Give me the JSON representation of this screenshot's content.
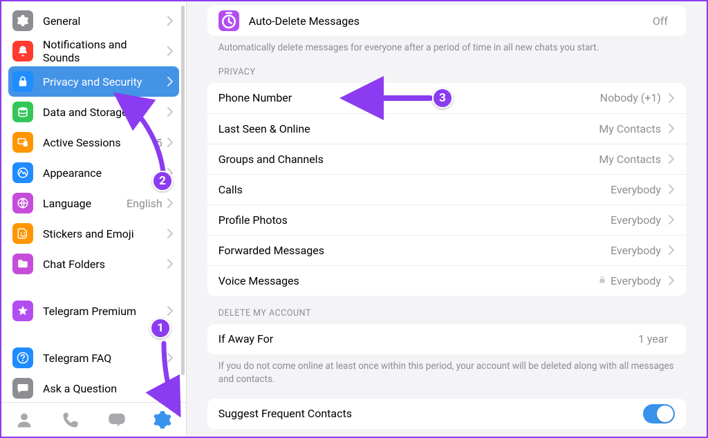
{
  "sidebar": {
    "items": [
      {
        "key": "general",
        "label": "General",
        "value": "",
        "selected": false,
        "icon": "gear",
        "icon_bg": "#8d8d92",
        "icon_fg": "#ffffff"
      },
      {
        "key": "notifications",
        "label": "Notifications and Sounds",
        "value": "",
        "selected": false,
        "icon": "bell",
        "icon_bg": "#ff3b30",
        "icon_fg": "#ffffff"
      },
      {
        "key": "privacy",
        "label": "Privacy and Security",
        "value": "",
        "selected": true,
        "icon": "lock",
        "icon_bg": "#1f8cff",
        "icon_fg": "#ffffff"
      },
      {
        "key": "data",
        "label": "Data and Storage",
        "value": "",
        "selected": false,
        "icon": "storage",
        "icon_bg": "#33c759",
        "icon_fg": "#ffffff"
      },
      {
        "key": "sessions",
        "label": "Active Sessions",
        "value": "5",
        "selected": false,
        "icon": "sessions",
        "icon_bg": "#ff9501",
        "icon_fg": "#ffffff"
      },
      {
        "key": "appearance",
        "label": "Appearance",
        "value": "",
        "selected": false,
        "icon": "appearance",
        "icon_bg": "#1f8cff",
        "icon_fg": "#ffffff"
      },
      {
        "key": "language",
        "label": "Language",
        "value": "English",
        "selected": false,
        "icon": "globe",
        "icon_bg": "#c64dd9",
        "icon_fg": "#ffffff"
      },
      {
        "key": "stickers",
        "label": "Stickers and Emoji",
        "value": "",
        "selected": false,
        "icon": "sticker",
        "icon_bg": "#ff9501",
        "icon_fg": "#ffffff"
      },
      {
        "key": "folders",
        "label": "Chat Folders",
        "value": "",
        "selected": false,
        "icon": "folder",
        "icon_bg": "#c64dd9",
        "icon_fg": "#ffffff"
      },
      {
        "key": "gap1",
        "gap": true
      },
      {
        "key": "premium",
        "label": "Telegram Premium",
        "value": "",
        "selected": false,
        "icon": "star",
        "icon_bg": "#b34df0",
        "icon_fg": "#ffffff"
      },
      {
        "key": "gap2",
        "gap": true
      },
      {
        "key": "faq",
        "label": "Telegram FAQ",
        "value": "",
        "selected": false,
        "icon": "question",
        "icon_bg": "#1f8cff",
        "icon_fg": "#ffffff"
      },
      {
        "key": "ask",
        "label": "Ask a Question",
        "value": "",
        "selected": false,
        "icon": "chat",
        "icon_bg": "#8d8d92",
        "icon_fg": "#ffffff"
      }
    ],
    "tabs": {
      "contacts": "contacts",
      "calls": "calls",
      "chats": "chats",
      "settings": "settings",
      "active": "settings"
    }
  },
  "main": {
    "auto_delete": {
      "label": "Auto-Delete Messages",
      "value": "Off",
      "footer": "Automatically delete messages for everyone after a period of time in all new chats you start."
    },
    "privacy_header": "PRIVACY",
    "privacy_rows": [
      {
        "key": "phone",
        "label": "Phone Number",
        "value": "Nobody (+1)"
      },
      {
        "key": "lastseen",
        "label": "Last Seen & Online",
        "value": "My Contacts"
      },
      {
        "key": "groups",
        "label": "Groups and Channels",
        "value": "My Contacts"
      },
      {
        "key": "calls",
        "label": "Calls",
        "value": "Everybody"
      },
      {
        "key": "photos",
        "label": "Profile Photos",
        "value": "Everybody"
      },
      {
        "key": "forwarded",
        "label": "Forwarded Messages",
        "value": "Everybody"
      },
      {
        "key": "voice",
        "label": "Voice Messages",
        "value": "Everybody",
        "locked": true
      }
    ],
    "delete_header": "DELETE MY ACCOUNT",
    "delete_row": {
      "label": "If Away For",
      "value": "1 year"
    },
    "delete_footer": "If you do not come online at least once within this period, your account will be deleted along with all messages and contacts.",
    "suggest_row": {
      "label": "Suggest Frequent Contacts",
      "on": true
    }
  },
  "annotations": {
    "step1": "1",
    "step2": "2",
    "step3": "3"
  },
  "colors": {
    "accent": "#3793ec",
    "annotation": "#8b3bf0",
    "selected_row": "#4393e6"
  }
}
